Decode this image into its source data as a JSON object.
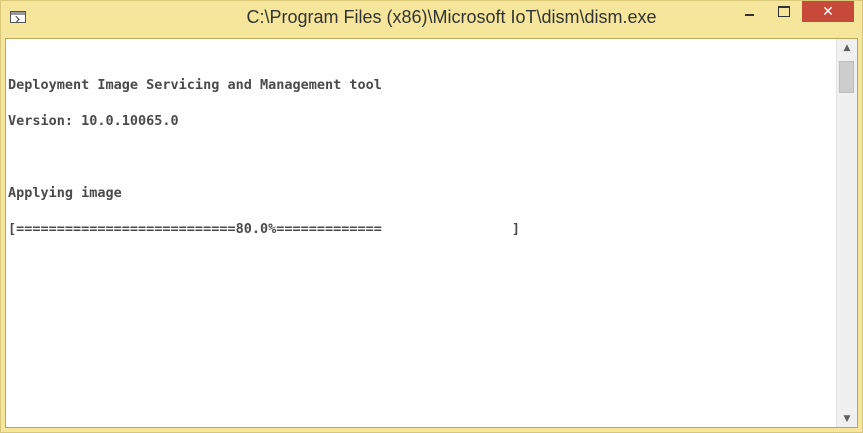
{
  "window": {
    "title": "C:\\Program Files (x86)\\Microsoft IoT\\dism\\dism.exe",
    "system_icon": "console-window-icon",
    "controls": {
      "minimize": "minimize-icon",
      "maximize": "maximize-icon",
      "close": "close-icon",
      "close_glyph": "✕"
    },
    "frame_color": "#f6e69c",
    "close_color": "#c7493a"
  },
  "console": {
    "lines": [
      "Deployment Image Servicing and Management tool",
      "Version: 10.0.10065.0",
      "",
      "Applying image",
      "[===========================80.0%=============                ]"
    ],
    "progress": {
      "percent": 80.0,
      "label": "80.0%"
    }
  },
  "scrollbar": {
    "up_arrow": "▲",
    "down_arrow": "▼"
  }
}
